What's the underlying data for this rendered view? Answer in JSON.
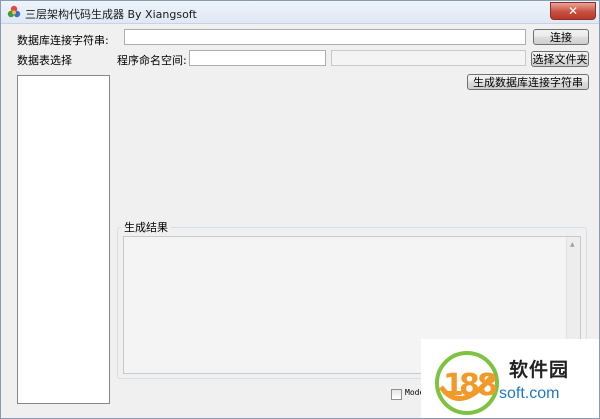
{
  "window": {
    "title": "三层架构代码生成器  By Xiangsoft",
    "close_label": "✕"
  },
  "connection": {
    "label": "数据库连接字符串:",
    "value": "",
    "connect_button": "连接"
  },
  "tables": {
    "label": "数据表选择",
    "items": []
  },
  "namespace": {
    "label": "程序命名空间:",
    "value": "",
    "folder_path": "",
    "choose_folder_button": "选择文件夹"
  },
  "generate_connection_button": "生成数据库连接字符串",
  "result": {
    "group_title": "生成结果",
    "text": ""
  },
  "model_checkbox": {
    "label": "Mode",
    "checked": false
  },
  "watermark": {
    "logo_text": "188",
    "text_cn": "软件园",
    "text_url": "soft.com"
  }
}
